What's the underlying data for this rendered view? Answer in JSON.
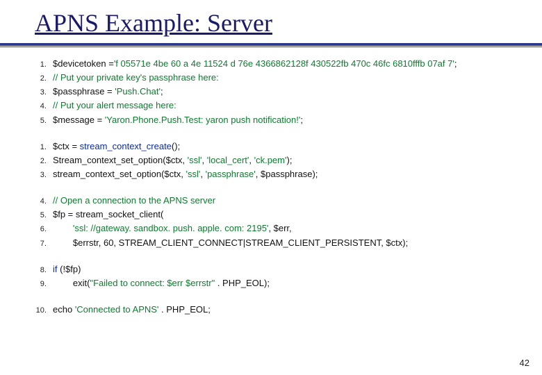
{
  "title": "APNS Example: Server",
  "page_number": "42",
  "blocks": [
    {
      "start": 1,
      "lines": [
        [
          {
            "t": "$devicetoken ="
          },
          {
            "t": "'f 05571e 4be 60 a 4e 11524 d 76e 4366862128f 430522fb 470c 46fc 6810fffb 07af 7'",
            "c": "kw-green"
          },
          {
            "t": ";"
          }
        ],
        [
          {
            "t": "// Put your private key's passphrase here:",
            "c": "kw-green"
          }
        ],
        [
          {
            "t": "$passphrase = "
          },
          {
            "t": "'Push.Chat'",
            "c": "kw-green"
          },
          {
            "t": ";"
          }
        ],
        [
          {
            "t": "// Put your alert message here:",
            "c": "kw-green"
          }
        ],
        [
          {
            "t": "$message = "
          },
          {
            "t": "'Yaron.Phone.Push.Test: yaron push notification!'",
            "c": "kw-green"
          },
          {
            "t": ";"
          }
        ]
      ]
    },
    {
      "start": 1,
      "lines": [
        [
          {
            "t": "$ctx = "
          },
          {
            "t": "stream_context_create",
            "c": "kw-blue"
          },
          {
            "t": "();"
          }
        ],
        [
          {
            "t": "Stream_context_set_option($ctx, "
          },
          {
            "t": "'ssl'",
            "c": "kw-green"
          },
          {
            "t": ", "
          },
          {
            "t": "'local_cert'",
            "c": "kw-green"
          },
          {
            "t": ", "
          },
          {
            "t": "'ck.pem'",
            "c": "kw-green"
          },
          {
            "t": ");"
          }
        ],
        [
          {
            "t": "stream_context_set_option($ctx, "
          },
          {
            "t": "'ssl'",
            "c": "kw-green"
          },
          {
            "t": ", "
          },
          {
            "t": "'passphrase'",
            "c": "kw-green"
          },
          {
            "t": ", $passphrase);"
          }
        ]
      ]
    },
    {
      "start": 4,
      "lines": [
        [
          {
            "t": "// Open a connection to the APNS server",
            "c": "kw-green"
          }
        ],
        [
          {
            "t": "$fp = stream_socket_client("
          }
        ],
        [
          {
            "t": "        "
          },
          {
            "t": "'ssl: //gateway. sandbox. push. apple. com: 2195'",
            "c": "kw-green"
          },
          {
            "t": ", $err,"
          }
        ],
        [
          {
            "t": "        $errstr, 60, STREAM_CLIENT_CONNECT|STREAM_CLIENT_PERSISTENT, $ctx);"
          }
        ]
      ]
    },
    {
      "start": 8,
      "lines": [
        [
          {
            "t": "if",
            "c": "kw-if"
          },
          {
            "t": " (!$fp)"
          }
        ],
        [
          {
            "t": "        exit("
          },
          {
            "t": "\"Failed to connect: $err $errstr\" ",
            "c": "kw-green"
          },
          {
            "t": ". PHP_EOL);"
          }
        ]
      ]
    },
    {
      "start": 10,
      "lines": [
        [
          {
            "t": "echo "
          },
          {
            "t": "'Connected to APNS' ",
            "c": "kw-green"
          },
          {
            "t": ". PHP_EOL;"
          }
        ]
      ]
    }
  ]
}
